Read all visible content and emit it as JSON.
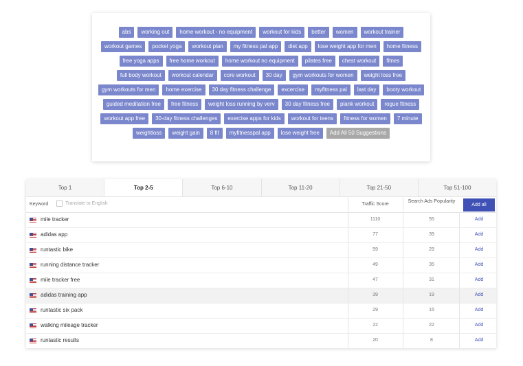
{
  "suggestions": {
    "tags": [
      "abs",
      "working out",
      "home workout - no equipment",
      "workout for kids",
      "better",
      "women",
      "workout trainer",
      "workout games",
      "pocket yoga",
      "workout plan",
      "my fitness pal app",
      "diet app",
      "lose weight app for men",
      "home fitness",
      "free yoga apps",
      "free home workout",
      "home workout no equipment",
      "pilates free",
      "chest workout",
      "fitnes",
      "full body workout",
      "workout calendar",
      "core workout",
      "30 day",
      "gym workouts for women",
      "weight loss free",
      "gym workouts for men",
      "home exercise",
      "30 day fitness challenge",
      "excercise",
      "myfitness pal",
      "last day",
      "booty workout",
      "guided meditation free",
      "free fitness",
      "weight loss running by verv",
      "30 day fitness free",
      "plank workout",
      "rogue fitness",
      "workout app free",
      "30-day fitness challenges",
      "exercise apps for kids",
      "workout for teens",
      "fitness for women",
      "7 minute",
      "weightloss",
      "weight gain",
      "8 fit",
      "myfitnesspal app",
      "lose weight free"
    ],
    "add_all_label": "Add All 50 Suggestions"
  },
  "tabs": [
    {
      "label": "Top 1",
      "active": false
    },
    {
      "label": "Top 2-5",
      "active": true
    },
    {
      "label": "Top 6-10",
      "active": false
    },
    {
      "label": "Top 11-20",
      "active": false
    },
    {
      "label": "Top 21-50",
      "active": false
    },
    {
      "label": "Top 51-100",
      "active": false
    }
  ],
  "table": {
    "keyword_header": "Keyword",
    "translate_label": "Translate to English",
    "traffic_header": "Traffic Score",
    "popularity_header": "Search Ads Popularity",
    "add_all_label": "Add all",
    "add_label": "Add",
    "rows": [
      {
        "keyword": "mile tracker",
        "traffic": "1110",
        "popularity": "55",
        "highlighted": false
      },
      {
        "keyword": "adidas app",
        "traffic": "77",
        "popularity": "39",
        "highlighted": false
      },
      {
        "keyword": "runtastic bike",
        "traffic": "59",
        "popularity": "29",
        "highlighted": false
      },
      {
        "keyword": "running distance tracker",
        "traffic": "49",
        "popularity": "35",
        "highlighted": false
      },
      {
        "keyword": "mile tracker free",
        "traffic": "47",
        "popularity": "31",
        "highlighted": false
      },
      {
        "keyword": "adidas training app",
        "traffic": "39",
        "popularity": "19",
        "highlighted": true
      },
      {
        "keyword": "runtastic six pack",
        "traffic": "29",
        "popularity": "15",
        "highlighted": false
      },
      {
        "keyword": "walking mileage tracker",
        "traffic": "22",
        "popularity": "22",
        "highlighted": false
      },
      {
        "keyword": "runtastic results",
        "traffic": "20",
        "popularity": "8",
        "highlighted": false
      }
    ]
  },
  "colors": {
    "tag_bg": "#7b87cd",
    "add_all_bg": "#a8a8a8",
    "accent": "#3f51b5"
  }
}
